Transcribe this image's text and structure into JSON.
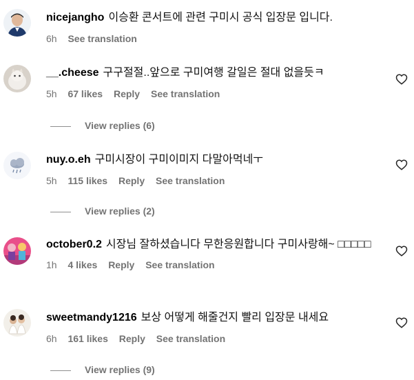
{
  "comments": [
    {
      "username": "nicejangho",
      "text": "이승환 콘서트에 관련 구미시 공식 입장문 입니다.",
      "time": "6h",
      "likes": "",
      "reply": "",
      "translate": "See translation",
      "view_replies": "",
      "avatar": "person-avatar"
    },
    {
      "username": "__.cheese",
      "text": "구구절절..앞으로 구미여행 갈일은 절대 없을듯ㅋ",
      "time": "5h",
      "likes": "67 likes",
      "reply": "Reply",
      "translate": "See translation",
      "view_replies": "View replies (6)",
      "avatar": "cat-avatar"
    },
    {
      "username": "nuy.o.eh",
      "text": "구미시장이 구미이미지 다말아먹네ㅜ",
      "time": "5h",
      "likes": "115 likes",
      "reply": "Reply",
      "translate": "See translation",
      "view_replies": "View replies (2)",
      "avatar": "cloud-avatar"
    },
    {
      "username": "october0.2",
      "text": "시장님 잘하셨습니다 무한응원합니다 구미사랑해~ □□□□□",
      "time": "1h",
      "likes": "4 likes",
      "reply": "Reply",
      "translate": "See translation",
      "view_replies": "",
      "avatar": "pink-avatar"
    },
    {
      "username": "sweetmandy1216",
      "text": "보상 어떻게 해줄건지 빨리 입장문 내세요",
      "time": "6h",
      "likes": "161 likes",
      "reply": "Reply",
      "translate": "See translation",
      "view_replies": "View replies (9)",
      "avatar": "group-avatar"
    }
  ],
  "colors": {
    "meta": "#737373",
    "text": "#111111"
  }
}
